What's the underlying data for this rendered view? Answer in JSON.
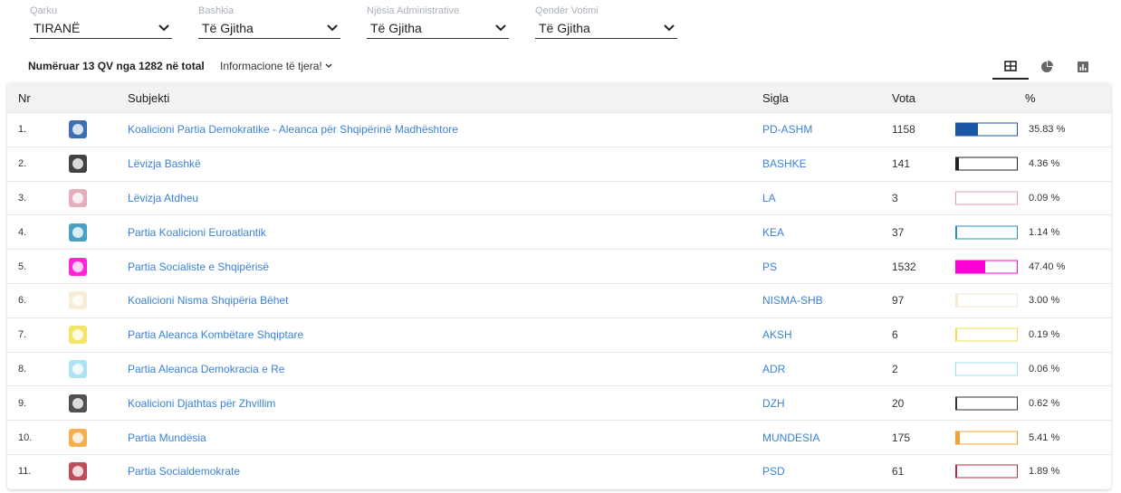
{
  "filters": [
    {
      "label": "Qarku",
      "value": "TIRANË"
    },
    {
      "label": "Bashkia",
      "value": "Të Gjitha"
    },
    {
      "label": "Njësia Administrative",
      "value": "Të Gjitha"
    },
    {
      "label": "Qendër Votimi",
      "value": "Të Gjitha"
    }
  ],
  "summary": "Numëruar 13 QV nga 1282 në total",
  "more_info": "Informacione të tjera!",
  "views": [
    "table-icon",
    "pie-chart-icon",
    "bar-chart-icon"
  ],
  "columns": {
    "nr": "Nr",
    "subjekti": "Subjekti",
    "sigla": "Sigla",
    "vota": "Vota",
    "pct": "%"
  },
  "rows": [
    {
      "nr": "1.",
      "name": "Koalicioni Partia Demokratike - Aleanca për Shqipërinë Madhështore",
      "sigla": "PD-ASHM",
      "vota": "1158",
      "pct": "35.83 %",
      "share": 35.83,
      "color": "#1b57a6"
    },
    {
      "nr": "2.",
      "name": "Lëvizja Bashkë",
      "sigla": "BASHKE",
      "vota": "141",
      "pct": "4.36 %",
      "share": 4.36,
      "color": "#222222"
    },
    {
      "nr": "3.",
      "name": "Lëvizja Atdheu",
      "sigla": "LA",
      "vota": "3",
      "pct": "0.09 %",
      "share": 0.09,
      "color": "#e0a0b0"
    },
    {
      "nr": "4.",
      "name": "Partia Koalicioni Euroatlantik",
      "sigla": "KEA",
      "vota": "37",
      "pct": "1.14 %",
      "share": 1.14,
      "color": "#2a8fb8"
    },
    {
      "nr": "5.",
      "name": "Partia Socialiste e Shqipërisë",
      "sigla": "PS",
      "vota": "1532",
      "pct": "47.40 %",
      "share": 47.4,
      "color": "#ff00d4"
    },
    {
      "nr": "6.",
      "name": "Koalicioni Nisma Shqipëria Bëhet",
      "sigla": "NISMA-SHB",
      "vota": "97",
      "pct": "3.00 %",
      "share": 3.0,
      "color": "#f5ead0"
    },
    {
      "nr": "7.",
      "name": "Partia Aleanca Kombëtare Shqiptare",
      "sigla": "AKSH",
      "vota": "6",
      "pct": "0.19 %",
      "share": 0.19,
      "color": "#f0e050"
    },
    {
      "nr": "8.",
      "name": "Partia Aleanca Demokracia e Re",
      "sigla": "ADR",
      "vota": "2",
      "pct": "0.06 %",
      "share": 0.06,
      "color": "#a0dcef"
    },
    {
      "nr": "9.",
      "name": "Koalicioni Djathtas për Zhvillim",
      "sigla": "DZH",
      "vota": "20",
      "pct": "0.62 %",
      "share": 0.62,
      "color": "#333333"
    },
    {
      "nr": "10.",
      "name": "Partia Mundësia",
      "sigla": "MUNDESIA",
      "vota": "175",
      "pct": "5.41 %",
      "share": 5.41,
      "color": "#f0a030"
    },
    {
      "nr": "11.",
      "name": "Partia Socialdemokrate",
      "sigla": "PSD",
      "vota": "61",
      "pct": "1.89 %",
      "share": 1.89,
      "color": "#b03040"
    }
  ]
}
